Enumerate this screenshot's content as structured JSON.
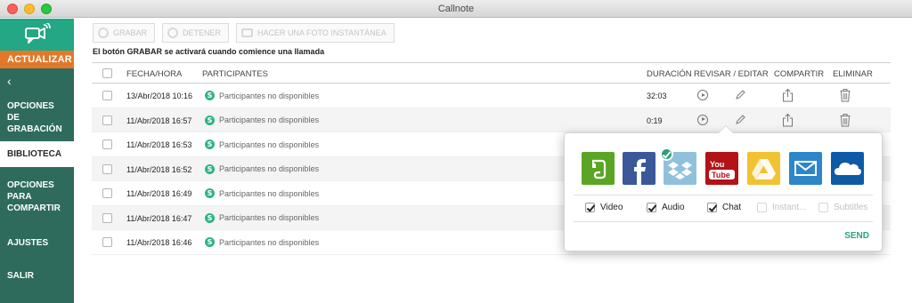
{
  "window": {
    "title": "Callnote"
  },
  "sidebar": {
    "update_label": "ACTUALIZAR",
    "back_glyph": "‹",
    "items": [
      {
        "label": "OPCIONES DE GRABACIÓN",
        "active": false
      },
      {
        "label": "BIBLIOTECA",
        "active": true
      },
      {
        "label": "OPCIONES PARA COMPARTIR",
        "active": false
      },
      {
        "label": "AJUSTES",
        "active": false
      },
      {
        "label": "SALIR",
        "active": false
      }
    ]
  },
  "toolbar": {
    "record_label": "GRABAR",
    "stop_label": "DETENER",
    "snapshot_label": "HACER UNA FOTO INSTANTÁNEA"
  },
  "notice": "El botón GRABAR se activará cuando comience una llamada",
  "table": {
    "headers": {
      "date": "FECHA/HORA",
      "participants": "PARTICIPANTES",
      "duration": "DURACIÓN",
      "review": "REVISAR / EDITAR",
      "share": "COMPARTIR",
      "delete": "ELIMINAR"
    },
    "rows": [
      {
        "date": "13/Abr/2018 10:16",
        "participants": "Participantes no disponibles",
        "duration": "32:03"
      },
      {
        "date": "11/Abr/2018 16:57",
        "participants": "Participantes no disponibles",
        "duration": "0:19"
      },
      {
        "date": "11/Abr/2018 16:53",
        "participants": "Participantes no disponibles",
        "duration": ""
      },
      {
        "date": "11/Abr/2018 16:52",
        "participants": "Participantes no disponibles",
        "duration": ""
      },
      {
        "date": "11/Abr/2018 16:49",
        "participants": "Participantes no disponibles",
        "duration": ""
      },
      {
        "date": "11/Abr/2018 16:47",
        "participants": "Participantes no disponibles",
        "duration": ""
      },
      {
        "date": "11/Abr/2018 16:46",
        "participants": "Participantes no disponibles",
        "duration": ""
      }
    ]
  },
  "share_popover": {
    "services": [
      {
        "icon": "evernote-icon",
        "color": "#5ba525"
      },
      {
        "icon": "facebook-icon",
        "color": "#3b5998"
      },
      {
        "icon": "dropbox-icon",
        "color": "#8fc1dd",
        "selected": true
      },
      {
        "icon": "youtube-icon",
        "color": "#b31217"
      },
      {
        "icon": "google-drive-icon",
        "color": "#f1c232"
      },
      {
        "icon": "email-icon",
        "color": "#2d86c9"
      },
      {
        "icon": "onedrive-icon",
        "color": "#0e5aa7"
      }
    ],
    "options": [
      {
        "label": "Video",
        "checked": true,
        "enabled": true
      },
      {
        "label": "Audio",
        "checked": true,
        "enabled": true
      },
      {
        "label": "Chat",
        "checked": true,
        "enabled": true
      },
      {
        "label": "Instant...",
        "checked": false,
        "enabled": false
      },
      {
        "label": "Subtitles",
        "checked": false,
        "enabled": false
      }
    ],
    "send_label": "SEND"
  },
  "colors": {
    "sidebar_bg": "#2e6b5c",
    "logo_bg": "#24a784",
    "update_bg": "#e2792a",
    "accent": "#2aa57c"
  }
}
